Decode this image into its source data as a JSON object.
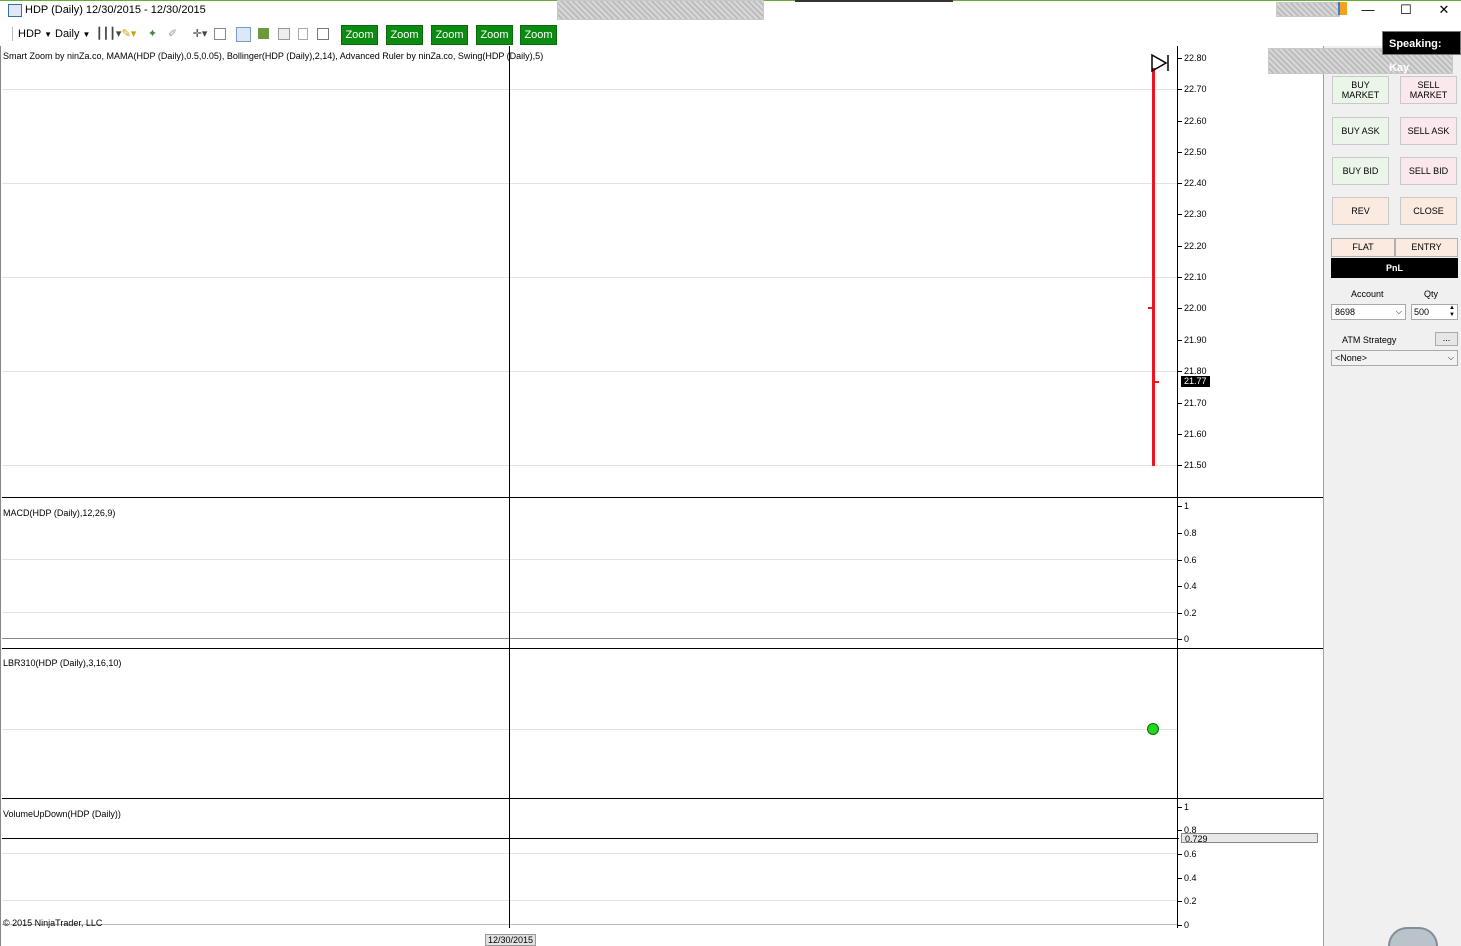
{
  "window": {
    "title": "HDP (Daily)  12/30/2015 - 12/30/2015",
    "minimize": "—",
    "maximize": "☐",
    "close": "✕"
  },
  "toolbar": {
    "instrument": "HDP",
    "interval": "Daily",
    "zoom_buttons": [
      "Zoom",
      "Zoom",
      "Zoom",
      "Zoom",
      "Zoom"
    ]
  },
  "speaking": "Speaking: Kay",
  "panels": {
    "price": {
      "title": "Smart Zoom by ninZa.co, MAMA(HDP (Daily),0.5,0.05), Bollinger(HDP (Daily),2,14), Advanced Ruler by ninZa.co, Swing(HDP (Daily),5)",
      "ticks": [
        "22.80",
        "22.70",
        "22.60",
        "22.50",
        "22.40",
        "22.30",
        "22.20",
        "22.10",
        "22.00",
        "21.90",
        "21.80",
        "21.70",
        "21.60",
        "21.50"
      ],
      "last_price": "21.77"
    },
    "macd": {
      "title": "MACD(HDP (Daily),12,26,9)",
      "ticks": [
        "1",
        "0.8",
        "0.6",
        "0.4",
        "0.2",
        "0"
      ]
    },
    "lbr": {
      "title": "LBR310(HDP (Daily),3,16,10)"
    },
    "volume": {
      "title": "VolumeUpDown(HDP (Daily))",
      "ticks": [
        "1",
        "0.8",
        "0.6",
        "0.4",
        "0.2",
        "0"
      ],
      "value": "0.729"
    }
  },
  "copyright": "© 2015 NinjaTrader, LLC",
  "x_axis_date": "12/30/2015",
  "chart_trader": {
    "buy_market": "BUY MARKET",
    "sell_market": "SELL MARKET",
    "buy_ask": "BUY ASK",
    "sell_ask": "SELL ASK",
    "buy_bid": "BUY BID",
    "sell_bid": "SELL BID",
    "rev": "REV",
    "close": "CLOSE",
    "flat": "FLAT",
    "entry": "ENTRY",
    "pnl": "PnL",
    "account_label": "Account",
    "qty_label": "Qty",
    "account_value": "8698",
    "qty_value": "500",
    "atm_label": "ATM Strategy",
    "atm_more": "...",
    "atm_value": "<None>"
  },
  "colors": {
    "zoom_button": "#0d8a12",
    "price_bar": "#e8181e",
    "lbr_dot": "#22d81e"
  }
}
